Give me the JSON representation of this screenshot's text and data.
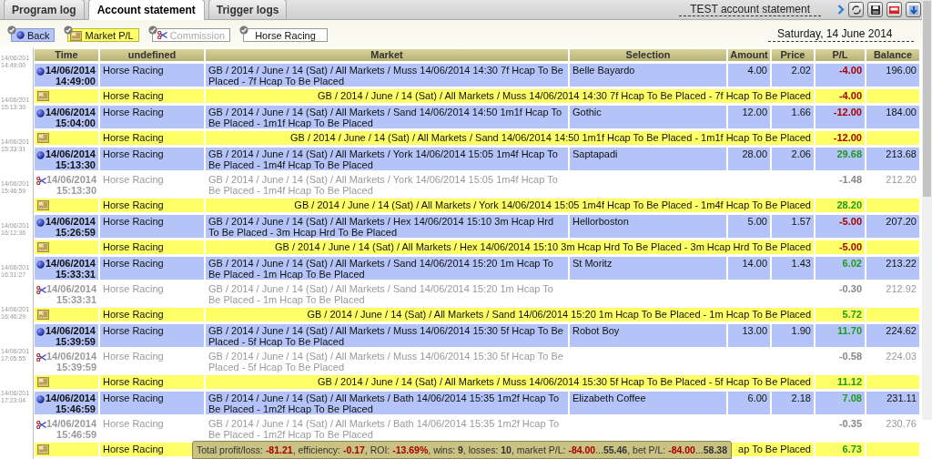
{
  "tabs": [
    {
      "label": "Program log",
      "selected": false
    },
    {
      "label": "Account statement",
      "selected": true
    },
    {
      "label": "Trigger logs",
      "selected": false
    }
  ],
  "account_title": "TEST account statement",
  "filters": [
    {
      "kind": "bet",
      "label": "Back",
      "enabled": true
    },
    {
      "kind": "market",
      "label": "Market P/L",
      "enabled": true
    },
    {
      "kind": "commission",
      "label": "Commission",
      "enabled": false
    },
    {
      "kind": "sport",
      "label": "Horse Racing",
      "enabled": true
    }
  ],
  "date": "Saturday, 14 June 2014",
  "log": [
    {
      "date": "14/06/201",
      "time": "14:49:00"
    },
    {
      "date": "14/06/201",
      "time": "15:13:30"
    },
    {
      "date": "14/06/201",
      "time": "15:33:31"
    },
    {
      "date": "14/06/201",
      "time": "15:46:59"
    },
    {
      "date": "14/06/201",
      "time": "16:12:36"
    },
    {
      "date": "14/06/201",
      "time": "16:31:27"
    },
    {
      "date": "14/06/201",
      "time": "16:46:29"
    },
    {
      "date": "14/06/201",
      "time": "17:05:55"
    },
    {
      "date": "14/06/201",
      "time": "17:23:04"
    }
  ],
  "table": {
    "columns": [
      "Time",
      "undefined",
      "Market",
      "Selection",
      "Amount",
      "Price",
      "P/L",
      "Balance"
    ],
    "rows": [
      {
        "kind": "bet",
        "date": "14/06/2014",
        "time": "14:49:00",
        "sport": "Horse Racing",
        "market": "GB / 2014 / June / 14 (Sat) / All Markets / Muss 14/06/2014 14:30 7f Hcap To Be Placed - 7f Hcap To Be Placed",
        "selection": "Belle Bayardo",
        "amount": "4.00",
        "price": "2.02",
        "pl": "-4.00",
        "loss": true,
        "balance": "196.00"
      },
      {
        "kind": "market",
        "sport": "Horse Racing",
        "market": "GB / 2014 / June / 14 (Sat) / All Markets / Muss 14/06/2014 14:30 7f Hcap To Be Placed - 7f Hcap To Be Placed",
        "pl": "-4.00",
        "loss": true
      },
      {
        "kind": "bet",
        "date": "14/06/2014",
        "time": "15:04:00",
        "sport": "Horse Racing",
        "market": "GB / 2014 / June / 14 (Sat) / All Markets / Sand 14/06/2014 14:50 1m1f Hcap To Be Placed - 1m1f Hcap To Be Placed",
        "selection": "Gothic",
        "amount": "12.00",
        "price": "1.66",
        "pl": "-12.00",
        "loss": true,
        "balance": "184.00"
      },
      {
        "kind": "market",
        "sport": "Horse Racing",
        "market": "GB / 2014 / June / 14 (Sat) / All Markets / Sand 14/06/2014 14:50 1m1f Hcap To Be Placed - 1m1f Hcap To Be Placed",
        "pl": "-12.00",
        "loss": true
      },
      {
        "kind": "bet",
        "date": "14/06/2014",
        "time": "15:13:30",
        "sport": "Horse Racing",
        "market": "GB / 2014 / June / 14 (Sat) / All Markets / York 14/06/2014 15:05 1m4f Hcap To Be Placed - 1m4f Hcap To Be Placed",
        "selection": "Saptapadi",
        "amount": "28.00",
        "price": "2.06",
        "pl": "29.68",
        "loss": false,
        "balance": "213.68"
      },
      {
        "kind": "commission",
        "date": "14/06/2014",
        "time": "15:13:30",
        "sport": "Horse Racing",
        "market": "GB / 2014 / June / 14 (Sat) / All Markets / York 14/06/2014 15:05 1m4f Hcap To Be Placed - 1m4f Hcap To Be Placed",
        "pl": "-1.48",
        "balance": "212.20"
      },
      {
        "kind": "market",
        "sport": "Horse Racing",
        "market": "GB / 2014 / June / 14 (Sat) / All Markets / York 14/06/2014 15:05 1m4f Hcap To Be Placed - 1m4f Hcap To Be Placed",
        "pl": "28.20",
        "loss": false
      },
      {
        "kind": "bet",
        "date": "14/06/2014",
        "time": "15:26:59",
        "sport": "Horse Racing",
        "market": "GB / 2014 / June / 14 (Sat) / All Markets / Hex 14/06/2014 15:10 3m Hcap Hrd To Be Placed - 3m Hcap Hrd To Be Placed",
        "selection": "Hellorboston",
        "amount": "5.00",
        "price": "1.57",
        "pl": "-5.00",
        "loss": true,
        "balance": "207.20"
      },
      {
        "kind": "market",
        "sport": "Horse Racing",
        "market": "GB / 2014 / June / 14 (Sat) / All Markets / Hex 14/06/2014 15:10 3m Hcap Hrd To Be Placed - 3m Hcap Hrd To Be Placed",
        "pl": "-5.00",
        "loss": true
      },
      {
        "kind": "bet",
        "date": "14/06/2014",
        "time": "15:33:31",
        "sport": "Horse Racing",
        "market": "GB / 2014 / June / 14 (Sat) / All Markets / Sand 14/06/2014 15:20 1m Hcap To Be Placed - 1m Hcap To Be Placed",
        "selection": "St Moritz",
        "amount": "14.00",
        "price": "1.43",
        "pl": "6.02",
        "loss": false,
        "balance": "213.22"
      },
      {
        "kind": "commission",
        "date": "14/06/2014",
        "time": "15:33:31",
        "sport": "Horse Racing",
        "market": "GB / 2014 / June / 14 (Sat) / All Markets / Sand 14/06/2014 15:20 1m Hcap To Be Placed - 1m Hcap To Be Placed",
        "pl": "-0.30",
        "balance": "212.92"
      },
      {
        "kind": "market",
        "sport": "Horse Racing",
        "market": "GB / 2014 / June / 14 (Sat) / All Markets / Sand 14/06/2014 15:20 1m Hcap To Be Placed - 1m Hcap To Be Placed",
        "pl": "5.72",
        "loss": false
      },
      {
        "kind": "bet",
        "date": "14/06/2014",
        "time": "15:39:59",
        "sport": "Horse Racing",
        "market": "GB / 2014 / June / 14 (Sat) / All Markets / Muss 14/06/2014 15:30 5f Hcap To Be Placed - 5f Hcap To Be Placed",
        "selection": "Robot Boy",
        "amount": "13.00",
        "price": "1.90",
        "pl": "11.70",
        "loss": false,
        "balance": "224.62"
      },
      {
        "kind": "commission",
        "date": "14/06/2014",
        "time": "15:39:59",
        "sport": "Horse Racing",
        "market": "GB / 2014 / June / 14 (Sat) / All Markets / Muss 14/06/2014 15:30 5f Hcap To Be Placed - 5f Hcap To Be Placed",
        "pl": "-0.58",
        "balance": "224.03"
      },
      {
        "kind": "market",
        "sport": "Horse Racing",
        "market": "GB / 2014 / June / 14 (Sat) / All Markets / Muss 14/06/2014 15:30 5f Hcap To Be Placed - 5f Hcap To Be Placed",
        "pl": "11.12",
        "loss": false
      },
      {
        "kind": "bet",
        "date": "14/06/2014",
        "time": "15:46:59",
        "sport": "Horse Racing",
        "market": "GB / 2014 / June / 14 (Sat) / All Markets / Bath 14/06/2014 15:35 1m2f Hcap To Be Placed - 1m2f Hcap To Be Placed",
        "selection": "Elizabeth Coffee",
        "amount": "6.00",
        "price": "2.18",
        "pl": "7.08",
        "loss": false,
        "balance": "231.11"
      },
      {
        "kind": "commission",
        "date": "14/06/2014",
        "time": "15:46:59",
        "sport": "Horse Racing",
        "market": "GB / 2014 / June / 14 (Sat) / All Markets / Bath 14/06/2014 15:35 1m2f Hcap To Be Placed - 1m2f Hcap To Be Placed",
        "pl": "-0.35",
        "balance": "230.76"
      },
      {
        "kind": "market",
        "sport": "Horse Racing",
        "market": "ap To Be Placed",
        "pl": "6.73",
        "loss": false
      }
    ]
  },
  "summary": [
    {
      "text": "Total profit/loss: ",
      "loss": false,
      "bold": false
    },
    {
      "text": "-81.21",
      "loss": true,
      "bold": true
    },
    {
      "text": ", efficiency: ",
      "loss": false,
      "bold": false
    },
    {
      "text": "-0.17",
      "loss": true,
      "bold": true
    },
    {
      "text": ", ROI: ",
      "loss": false,
      "bold": false
    },
    {
      "text": "-13.69%",
      "loss": true,
      "bold": true
    },
    {
      "text": ", wins: ",
      "loss": false,
      "bold": false
    },
    {
      "text": "9",
      "loss": false,
      "bold": true
    },
    {
      "text": ", losses: ",
      "loss": false,
      "bold": false
    },
    {
      "text": "10",
      "loss": false,
      "bold": true
    },
    {
      "text": ", market P/L: ",
      "loss": false,
      "bold": false
    },
    {
      "text": "-84.00",
      "loss": true,
      "bold": true
    },
    {
      "text": "...",
      "loss": false,
      "bold": false
    },
    {
      "text": "55.46",
      "loss": false,
      "bold": true
    },
    {
      "text": ", bet P/L: ",
      "loss": false,
      "bold": false
    },
    {
      "text": "-84.00",
      "loss": true,
      "bold": true
    },
    {
      "text": "...",
      "loss": false,
      "bold": false
    },
    {
      "text": "58.38",
      "loss": false,
      "bold": true
    }
  ]
}
